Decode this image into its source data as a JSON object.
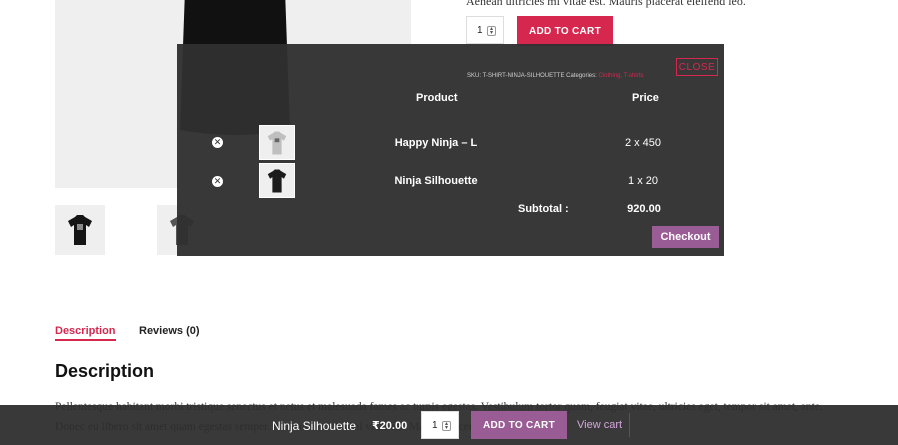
{
  "summary": {
    "excerpt": "Aenean ultricies mi vitae est. Mauris placerat eleifend leo.",
    "quantity": "1",
    "add_to_cart_label": "ADD TO CART"
  },
  "mini_cart": {
    "close_label": "CLOSE",
    "sku_prefix": "SKU: T-SHIRT-NINJA-SILHOUETTE Categories: ",
    "sku_categories": "Clothing, T-shirts",
    "header_product": "Product",
    "header_price": "Price",
    "items": [
      {
        "name": "Happy Ninja – L",
        "price": "2 x 450",
        "shirt_color": "#bfbfbf"
      },
      {
        "name": "Ninja Silhouette",
        "price": "1 x 20",
        "shirt_color": "#1c1c1c"
      }
    ],
    "subtotal_label": "Subtotal :",
    "subtotal_value": "920.00",
    "checkout_label": "Checkout"
  },
  "tabs": [
    {
      "label": "Description",
      "active": true
    },
    {
      "label": "Reviews (0)",
      "active": false
    }
  ],
  "description": {
    "title": "Description",
    "text": "Pellentesque habitant morbi tristique senectus et netus et malesuada fames ac turpis egestas. Vestibulum tortor quam, feugiat vitae, ultricies eget, tempor sit amet, ante. Donec eu libero sit amet quam egestas semper. Aenean ultricies mi vitae est. Mauris placerat eleifend leo."
  },
  "sticky_bar": {
    "product_name": "Ninja Silhouette",
    "price": "₹20.00",
    "quantity": "1",
    "add_to_cart_label": "ADD TO CART",
    "view_cart_label": "View cart"
  },
  "colors": {
    "accent": "#d6284f",
    "secondary": "#9a5c95",
    "overlay": "#303030",
    "gallery_bg": "#efefef"
  },
  "icons": {
    "remove": "remove-item-icon",
    "spinner": "spinner-icon",
    "shirt": "tshirt-icon"
  }
}
